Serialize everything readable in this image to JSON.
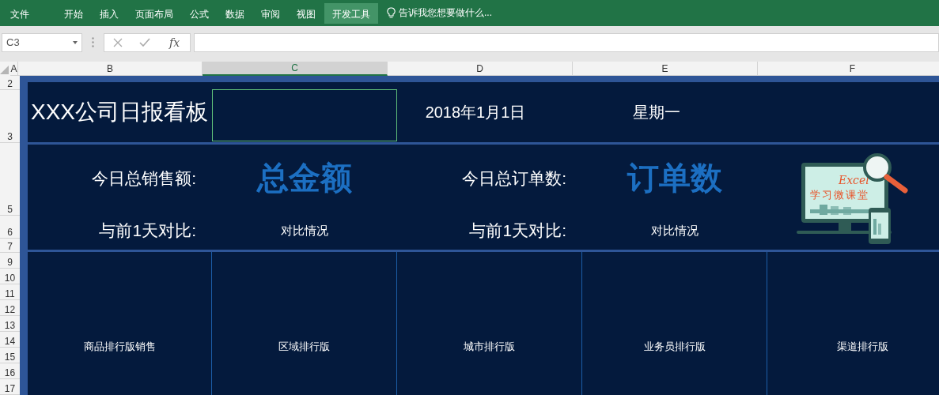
{
  "ribbon": {
    "tabs": [
      {
        "label": "文件",
        "selected": false
      },
      {
        "label": "开始",
        "selected": false
      },
      {
        "label": "插入",
        "selected": false
      },
      {
        "label": "页面布局",
        "selected": false
      },
      {
        "label": "公式",
        "selected": false
      },
      {
        "label": "数据",
        "selected": false
      },
      {
        "label": "审阅",
        "selected": false
      },
      {
        "label": "视图",
        "selected": false
      },
      {
        "label": "开发工具",
        "selected": true
      }
    ],
    "tell_me": "告诉我您想要做什么..."
  },
  "formula_bar": {
    "name_box": "C3",
    "function_label": "fx"
  },
  "column_headers": [
    {
      "label": "A",
      "selected": false
    },
    {
      "label": "B",
      "selected": false
    },
    {
      "label": "C",
      "selected": true
    },
    {
      "label": "D",
      "selected": false
    },
    {
      "label": "E",
      "selected": false
    },
    {
      "label": "F",
      "selected": false
    }
  ],
  "row_headers": [
    "2",
    "3",
    "5",
    "6",
    "7",
    "9",
    "10",
    "11",
    "12",
    "13",
    "14",
    "15",
    "16",
    "17"
  ],
  "dashboard": {
    "title": "XXX公司日报看板",
    "date": "2018年1月1日",
    "weekday": "星期一",
    "metrics": [
      {
        "label": "今日总销售额:",
        "value": "总金额",
        "compare_label": "与前1天对比:",
        "compare_value": "对比情况"
      },
      {
        "label": "今日总订单数:",
        "value": "订单数",
        "compare_label": "与前1天对比:",
        "compare_value": "对比情况"
      }
    ],
    "logo": {
      "title": "Excel",
      "subtitle": "学习微课堂"
    },
    "rankings": [
      "商品排行版销售",
      "区域排行版",
      "城市排行版",
      "业务员排行版",
      "渠道排行版"
    ]
  }
}
